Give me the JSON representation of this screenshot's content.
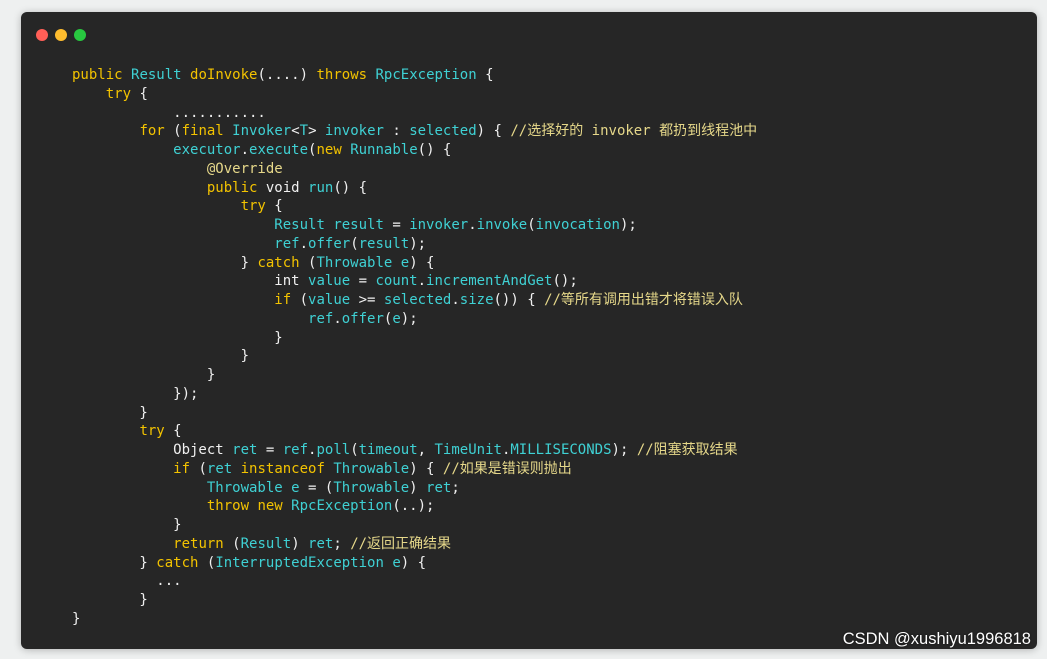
{
  "window": {
    "traffic_lights": [
      {
        "name": "close",
        "color": "#ff5f57"
      },
      {
        "name": "minimize",
        "color": "#febc2e"
      },
      {
        "name": "maximize",
        "color": "#28c840"
      }
    ]
  },
  "code": {
    "lines": [
      [
        [
          "k",
          "public "
        ],
        [
          "t",
          "Result "
        ],
        [
          "m",
          "doInvoke"
        ],
        [
          "w",
          "(....) "
        ],
        [
          "k",
          "throws "
        ],
        [
          "t",
          "RpcException "
        ],
        [
          "w",
          "{"
        ]
      ],
      [
        [
          "w",
          "    "
        ],
        [
          "k",
          "try "
        ],
        [
          "w",
          "{"
        ]
      ],
      [
        [
          "w",
          "            ..........."
        ]
      ],
      [
        [
          "w",
          "        "
        ],
        [
          "k",
          "for "
        ],
        [
          "w",
          "("
        ],
        [
          "k",
          "final "
        ],
        [
          "t",
          "Invoker"
        ],
        [
          "w",
          "<"
        ],
        [
          "t",
          "T"
        ],
        [
          "w",
          "> "
        ],
        [
          "t",
          "invoker "
        ],
        [
          "w",
          ": "
        ],
        [
          "t",
          "selected"
        ],
        [
          "w",
          ") { "
        ],
        [
          "c",
          "//选择好的 invoker 都扔到线程池中"
        ]
      ],
      [
        [
          "w",
          "            "
        ],
        [
          "t",
          "executor"
        ],
        [
          "w",
          "."
        ],
        [
          "t",
          "execute"
        ],
        [
          "w",
          "("
        ],
        [
          "k",
          "new "
        ],
        [
          "t",
          "Runnable"
        ],
        [
          "w",
          "() {"
        ]
      ],
      [
        [
          "w",
          "                "
        ],
        [
          "c",
          "@Override"
        ]
      ],
      [
        [
          "w",
          "                "
        ],
        [
          "k",
          "public "
        ],
        [
          "w",
          "void "
        ],
        [
          "t",
          "run"
        ],
        [
          "w",
          "() {"
        ]
      ],
      [
        [
          "w",
          "                    "
        ],
        [
          "k",
          "try "
        ],
        [
          "w",
          "{"
        ]
      ],
      [
        [
          "w",
          "                        "
        ],
        [
          "t",
          "Result "
        ],
        [
          "t",
          "result "
        ],
        [
          "w",
          "= "
        ],
        [
          "t",
          "invoker"
        ],
        [
          "w",
          "."
        ],
        [
          "t",
          "invoke"
        ],
        [
          "w",
          "("
        ],
        [
          "t",
          "invocation"
        ],
        [
          "w",
          ");"
        ]
      ],
      [
        [
          "w",
          "                        "
        ],
        [
          "t",
          "ref"
        ],
        [
          "w",
          "."
        ],
        [
          "t",
          "offer"
        ],
        [
          "w",
          "("
        ],
        [
          "t",
          "result"
        ],
        [
          "w",
          ");"
        ]
      ],
      [
        [
          "w",
          "                    } "
        ],
        [
          "k",
          "catch "
        ],
        [
          "w",
          "("
        ],
        [
          "t",
          "Throwable "
        ],
        [
          "t",
          "e"
        ],
        [
          "w",
          ") {"
        ]
      ],
      [
        [
          "w",
          "                        int "
        ],
        [
          "t",
          "value "
        ],
        [
          "w",
          "= "
        ],
        [
          "t",
          "count"
        ],
        [
          "w",
          "."
        ],
        [
          "t",
          "incrementAndGet"
        ],
        [
          "w",
          "();"
        ]
      ],
      [
        [
          "w",
          "                        "
        ],
        [
          "k",
          "if "
        ],
        [
          "w",
          "("
        ],
        [
          "t",
          "value "
        ],
        [
          "w",
          ">= "
        ],
        [
          "t",
          "selected"
        ],
        [
          "w",
          "."
        ],
        [
          "t",
          "size"
        ],
        [
          "w",
          "()) { "
        ],
        [
          "c",
          "//等所有调用出错才将错误入队"
        ]
      ],
      [
        [
          "w",
          "                            "
        ],
        [
          "t",
          "ref"
        ],
        [
          "w",
          "."
        ],
        [
          "t",
          "offer"
        ],
        [
          "w",
          "("
        ],
        [
          "t",
          "e"
        ],
        [
          "w",
          ");"
        ]
      ],
      [
        [
          "w",
          "                        }"
        ]
      ],
      [
        [
          "w",
          "                    }"
        ]
      ],
      [
        [
          "w",
          "                }"
        ]
      ],
      [
        [
          "w",
          "            });"
        ]
      ],
      [
        [
          "w",
          "        }"
        ]
      ],
      [
        [
          "w",
          "        "
        ],
        [
          "k",
          "try "
        ],
        [
          "w",
          "{"
        ]
      ],
      [
        [
          "w",
          "            Object "
        ],
        [
          "t",
          "ret "
        ],
        [
          "w",
          "= "
        ],
        [
          "t",
          "ref"
        ],
        [
          "w",
          "."
        ],
        [
          "t",
          "poll"
        ],
        [
          "w",
          "("
        ],
        [
          "t",
          "timeout"
        ],
        [
          "w",
          ", "
        ],
        [
          "t",
          "TimeUnit"
        ],
        [
          "w",
          "."
        ],
        [
          "t",
          "MILLISECONDS"
        ],
        [
          "w",
          "); "
        ],
        [
          "c",
          "//阻塞获取结果"
        ]
      ],
      [
        [
          "w",
          "            "
        ],
        [
          "k",
          "if "
        ],
        [
          "w",
          "("
        ],
        [
          "t",
          "ret "
        ],
        [
          "k",
          "instanceof "
        ],
        [
          "t",
          "Throwable"
        ],
        [
          "w",
          ") { "
        ],
        [
          "c",
          "//如果是错误则抛出"
        ]
      ],
      [
        [
          "w",
          "                "
        ],
        [
          "t",
          "Throwable "
        ],
        [
          "t",
          "e "
        ],
        [
          "w",
          "= ("
        ],
        [
          "t",
          "Throwable"
        ],
        [
          "w",
          ") "
        ],
        [
          "t",
          "ret"
        ],
        [
          "w",
          ";"
        ]
      ],
      [
        [
          "w",
          "                "
        ],
        [
          "k",
          "throw "
        ],
        [
          "k",
          "new "
        ],
        [
          "t",
          "RpcException"
        ],
        [
          "w",
          "(..);"
        ]
      ],
      [
        [
          "w",
          "            }"
        ]
      ],
      [
        [
          "w",
          "            "
        ],
        [
          "k",
          "return "
        ],
        [
          "w",
          "("
        ],
        [
          "t",
          "Result"
        ],
        [
          "w",
          ") "
        ],
        [
          "t",
          "ret"
        ],
        [
          "w",
          "; "
        ],
        [
          "c",
          "//返回正确结果"
        ]
      ],
      [
        [
          "w",
          "        } "
        ],
        [
          "k",
          "catch "
        ],
        [
          "w",
          "("
        ],
        [
          "t",
          "InterruptedException "
        ],
        [
          "t",
          "e"
        ],
        [
          "w",
          ") {"
        ]
      ],
      [
        [
          "w",
          "          ..."
        ]
      ],
      [
        [
          "w",
          "        }"
        ]
      ],
      [
        [
          "w",
          "}"
        ]
      ]
    ]
  },
  "watermark": "CSDN @xushiyu1996818"
}
